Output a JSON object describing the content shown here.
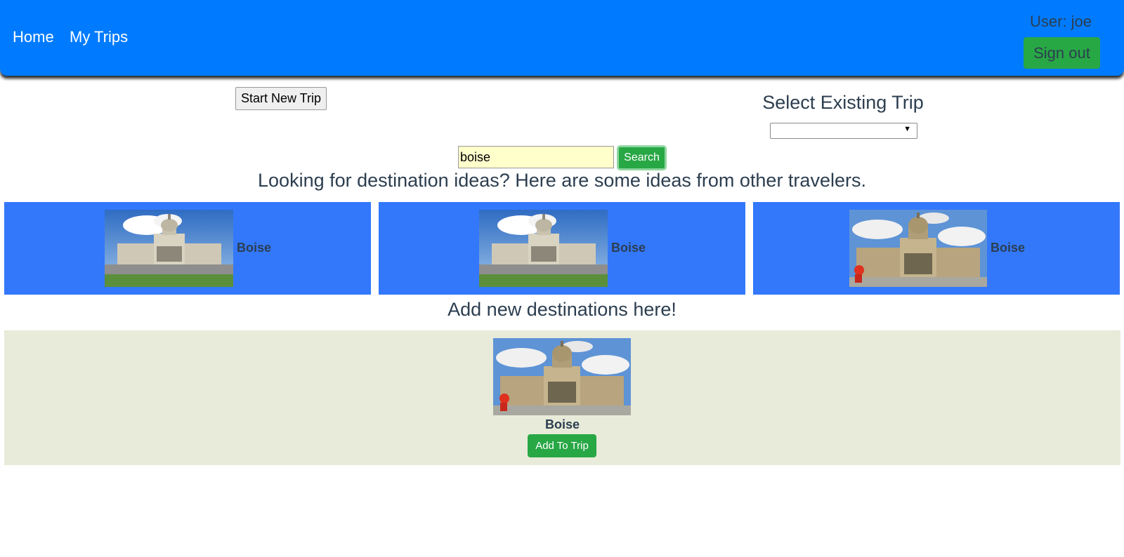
{
  "nav": {
    "home": "Home",
    "my_trips": "My Trips",
    "user_label": "User: joe",
    "sign_out": "Sign out"
  },
  "trip_controls": {
    "start_new_trip": "Start New Trip",
    "select_existing_title": "Select Existing Trip",
    "select_value": ""
  },
  "search": {
    "value": "boise",
    "button": "Search"
  },
  "ideas": {
    "heading": "Looking for destination ideas? Here are some ideas from other travelers.",
    "cards": [
      {
        "name": "Boise",
        "image": "capitol-building-photo"
      },
      {
        "name": "Boise",
        "image": "capitol-building-photo"
      },
      {
        "name": "Boise",
        "image": "capitol-building-photo"
      }
    ]
  },
  "add_destinations": {
    "heading": "Add new destinations here!",
    "result": {
      "name": "Boise",
      "image": "capitol-building-photo"
    },
    "add_button": "Add To Trip"
  },
  "colors": {
    "navbar": "#007bff",
    "green": "#28a745",
    "card": "#3378fb",
    "panel": "#e8ebd9",
    "text": "#2c3e50"
  }
}
